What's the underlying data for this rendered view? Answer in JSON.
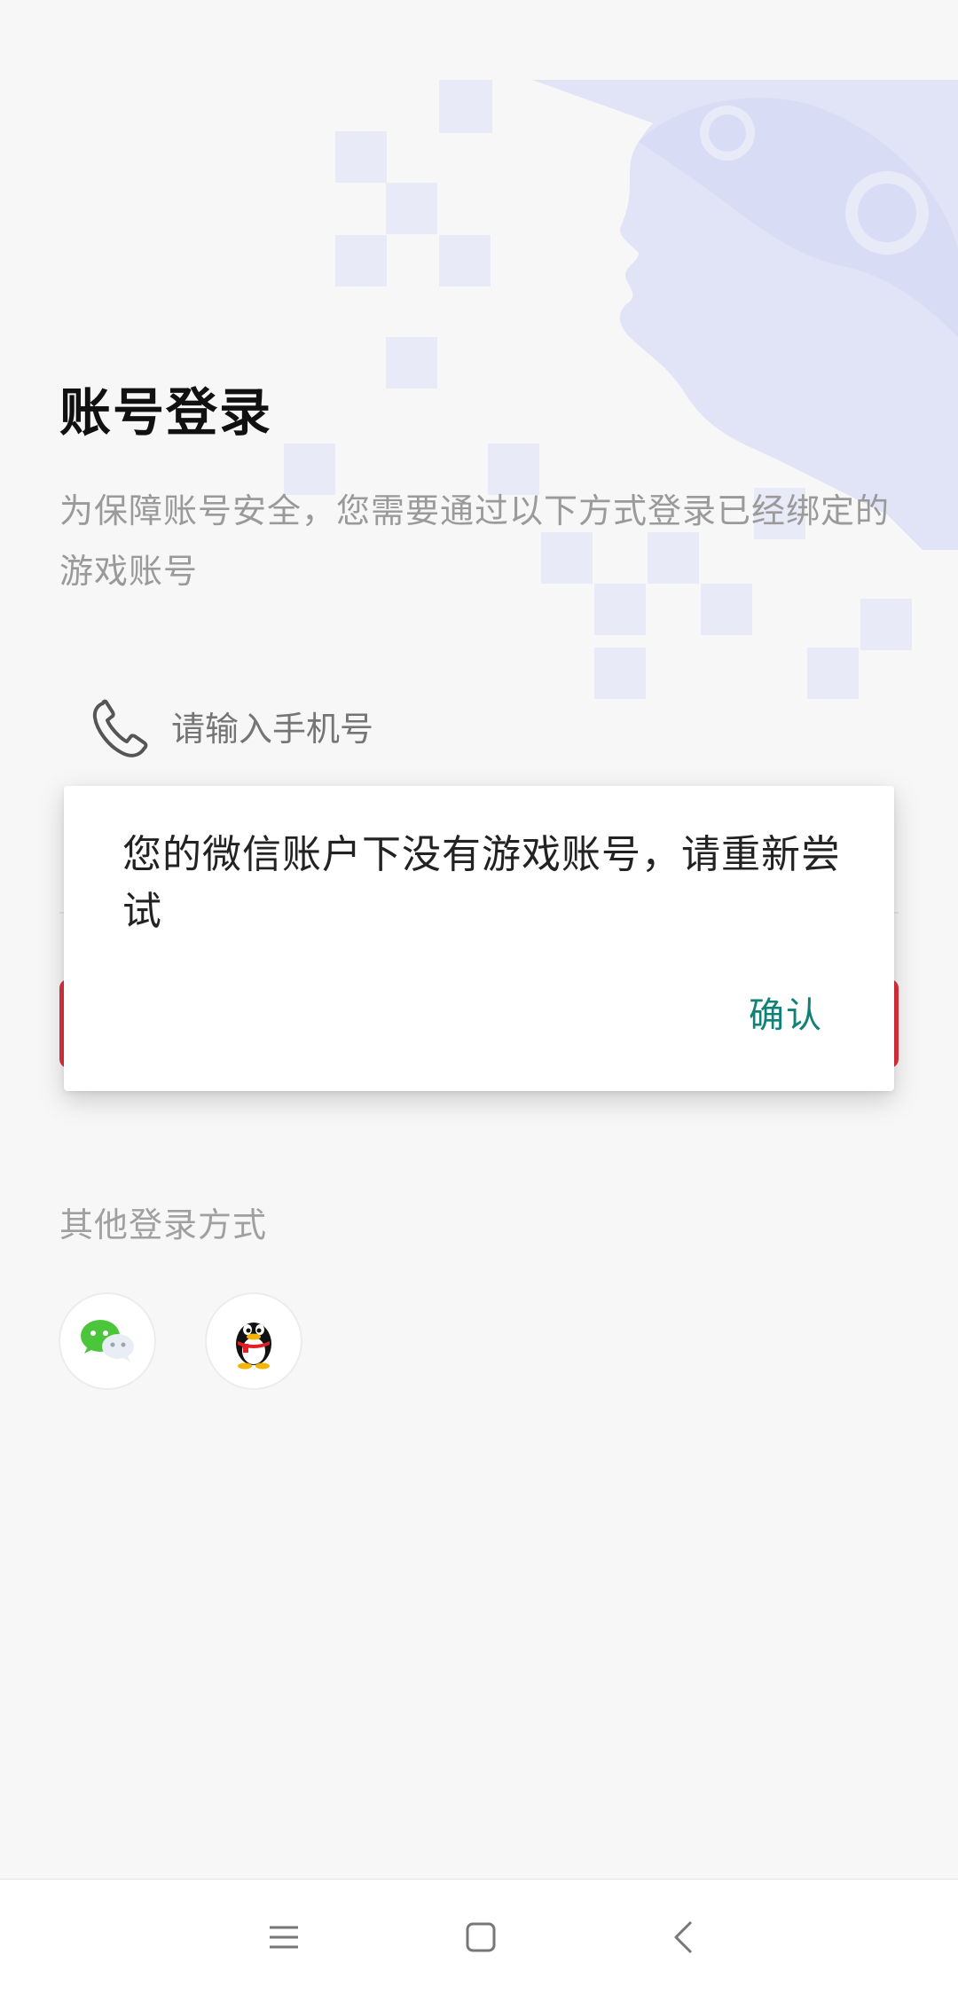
{
  "login": {
    "title": "账号登录",
    "subtitle": "为保障账号安全，您需要通过以下方式登录已经绑定的游戏账号",
    "phone_placeholder": "请输入手机号",
    "other_methods_label": "其他登录方式",
    "social": [
      {
        "name": "wechat-icon"
      },
      {
        "name": "qq-icon"
      }
    ],
    "accent_color": "#e0313d"
  },
  "dialog": {
    "message": "您的微信账户下没有游戏账号，请重新尝试",
    "confirm_label": "确认",
    "confirm_color": "#0f8176"
  },
  "nav": {
    "buttons": [
      "menu-icon",
      "home-icon",
      "back-icon"
    ]
  }
}
